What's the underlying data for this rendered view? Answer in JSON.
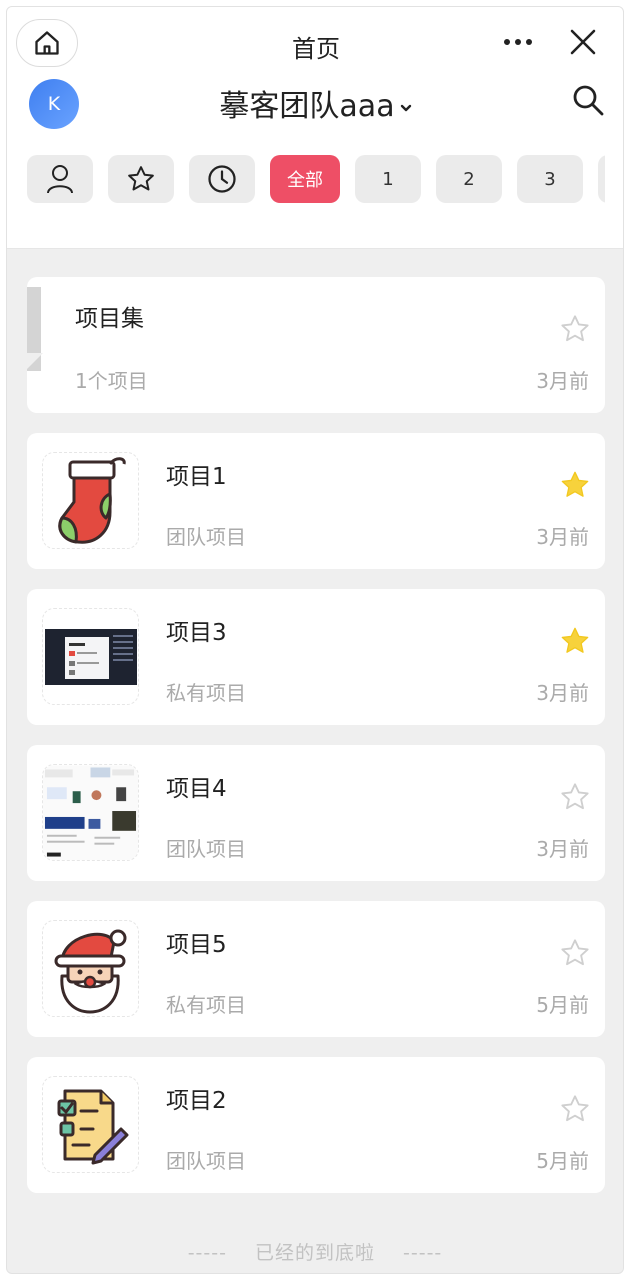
{
  "header": {
    "title": "首页",
    "team_name": "摹客团队aaa",
    "avatar_letter": "K"
  },
  "filters": [
    {
      "kind": "icon",
      "icon": "user-icon"
    },
    {
      "kind": "icon",
      "icon": "star-icon"
    },
    {
      "kind": "icon",
      "icon": "clock-icon"
    },
    {
      "kind": "text",
      "label": "全部",
      "active": true
    },
    {
      "kind": "text",
      "label": "1"
    },
    {
      "kind": "text",
      "label": "2"
    },
    {
      "kind": "text",
      "label": "3"
    }
  ],
  "project_set": {
    "name": "项目集",
    "count": "1个项目",
    "time": "3月前",
    "starred": false
  },
  "projects": [
    {
      "name": "项目1",
      "type": "团队项目",
      "time": "3月前",
      "starred": true,
      "thumb": "sock-icon"
    },
    {
      "name": "项目3",
      "type": "私有项目",
      "time": "3月前",
      "starred": true,
      "thumb": "dark-screenshot"
    },
    {
      "name": "项目4",
      "type": "团队项目",
      "time": "3月前",
      "starred": false,
      "thumb": "web-collage"
    },
    {
      "name": "项目5",
      "type": "私有项目",
      "time": "5月前",
      "starred": false,
      "thumb": "santa-icon"
    },
    {
      "name": "项目2",
      "type": "团队项目",
      "time": "5月前",
      "starred": false,
      "thumb": "document-edit-icon"
    }
  ],
  "footer": {
    "dash_left": "-----",
    "text": "已经的到底啦",
    "dash_right": "-----"
  },
  "colors": {
    "accent": "#ee4f66",
    "star_filled": "#f7d23c",
    "avatar": "#4a86f0"
  }
}
